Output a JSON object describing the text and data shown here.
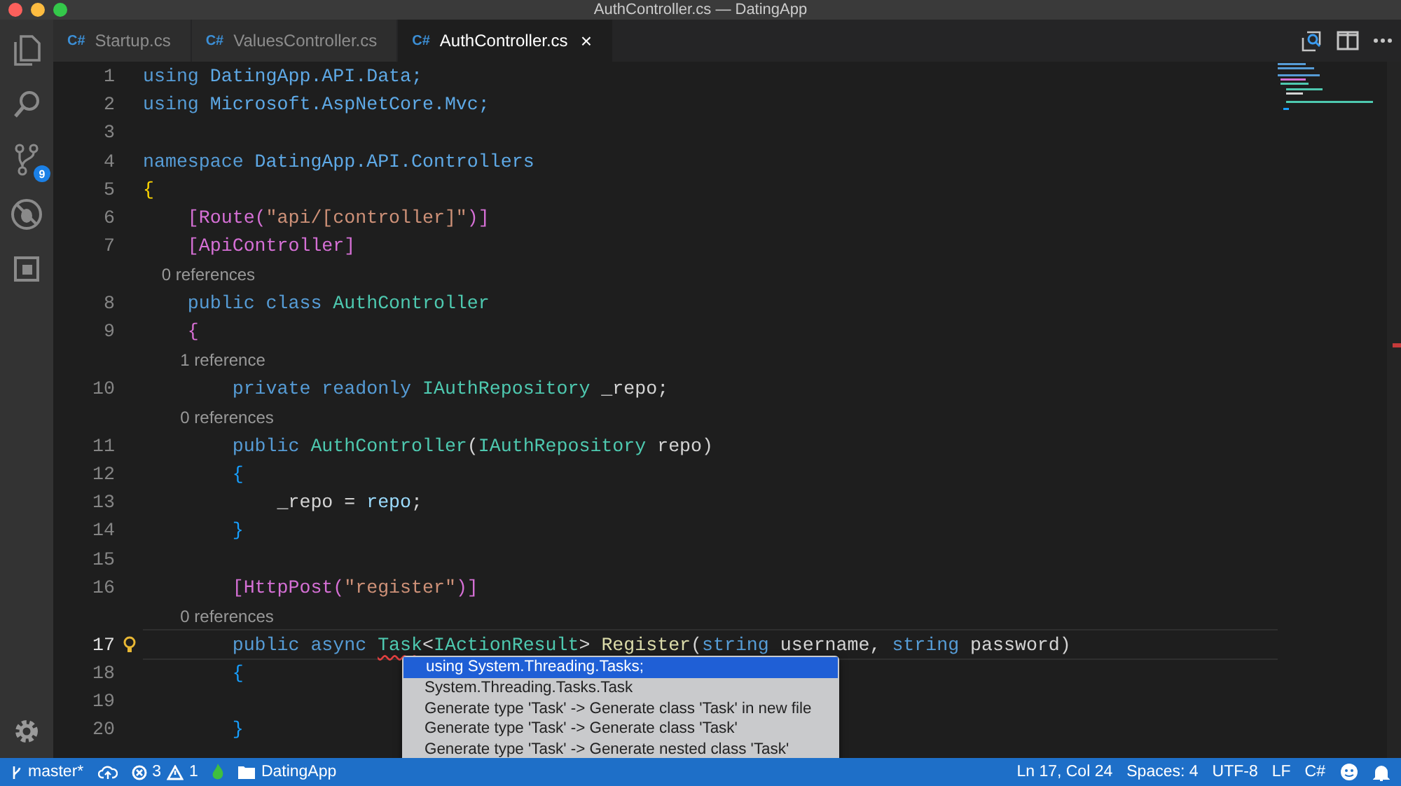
{
  "window": {
    "title": "AuthController.cs — DatingApp"
  },
  "activity_bar": {
    "source_control_badge": "9"
  },
  "tabs": [
    {
      "icon": "C#",
      "label": "Startup.cs",
      "selected": false
    },
    {
      "icon": "C#",
      "label": "ValuesController.cs",
      "selected": false
    },
    {
      "icon": "C#",
      "label": "AuthController.cs",
      "selected": true,
      "close": "×"
    }
  ],
  "lines": [
    {
      "kind": "code",
      "number": "1",
      "current": false,
      "lightbulb": false,
      "tokens": [
        {
          "text": "using",
          "kind": "kw"
        },
        {
          "text": " DatingApp.API.Data;",
          "kind": "ns"
        }
      ]
    },
    {
      "kind": "code",
      "number": "2",
      "current": false,
      "lightbulb": false,
      "tokens": [
        {
          "text": "using",
          "kind": "kw"
        },
        {
          "text": " Microsoft.AspNetCore.Mvc;",
          "kind": "ns"
        }
      ]
    },
    {
      "kind": "code",
      "number": "3",
      "current": false,
      "lightbulb": false
    },
    {
      "kind": "code",
      "number": "4",
      "current": false,
      "lightbulb": false,
      "tokens": [
        {
          "text": "namespace",
          "kind": "kw"
        },
        {
          "text": " DatingApp.API.Controllers",
          "kind": "ns"
        }
      ]
    },
    {
      "kind": "code",
      "number": "5",
      "current": false,
      "lightbulb": false,
      "tokens": [
        {
          "text": "{",
          "kind": "brace1"
        }
      ]
    },
    {
      "kind": "code",
      "number": "6",
      "current": false,
      "lightbulb": false,
      "tokens": [
        {
          "text": "    [Route(",
          "kind": "attr"
        },
        {
          "text": "\"api/[controller]\"",
          "kind": "str"
        },
        {
          "text": ")]",
          "kind": "attr"
        }
      ]
    },
    {
      "kind": "code",
      "number": "7",
      "current": false,
      "lightbulb": false,
      "tokens": [
        {
          "text": "    [ApiController]",
          "kind": "attr"
        }
      ]
    },
    {
      "kind": "lens",
      "text": "    0 references"
    },
    {
      "kind": "code",
      "number": "8",
      "current": false,
      "lightbulb": false,
      "tokens": [
        {
          "text": "    public class ",
          "kind": "kw"
        },
        {
          "text": "AuthController",
          "kind": "type"
        }
      ]
    },
    {
      "kind": "code",
      "number": "9",
      "current": false,
      "lightbulb": false,
      "tokens": [
        {
          "text": "    {",
          "kind": "brace2"
        }
      ]
    },
    {
      "kind": "lens",
      "text": "        1 reference"
    },
    {
      "kind": "code",
      "number": "10",
      "current": false,
      "lightbulb": false,
      "tokens": [
        {
          "text": "        private readonly ",
          "kind": "kw"
        },
        {
          "text": "IAuthRepository",
          "kind": "type"
        },
        {
          "text": " _repo;",
          "kind": "plain"
        }
      ]
    },
    {
      "kind": "lens",
      "text": "        0 references"
    },
    {
      "kind": "code",
      "number": "11",
      "current": false,
      "lightbulb": false,
      "tokens": [
        {
          "text": "        public ",
          "kind": "kw"
        },
        {
          "text": "AuthController",
          "kind": "type"
        },
        {
          "text": "(",
          "kind": "plain"
        },
        {
          "text": "IAuthRepository",
          "kind": "type"
        },
        {
          "text": " repo)",
          "kind": "plain"
        }
      ]
    },
    {
      "kind": "code",
      "number": "12",
      "current": false,
      "lightbulb": false,
      "tokens": [
        {
          "text": "        {",
          "kind": "brace3"
        }
      ]
    },
    {
      "kind": "code",
      "number": "13",
      "current": false,
      "lightbulb": false,
      "tokens": [
        {
          "text": "            _repo = ",
          "kind": "plain"
        },
        {
          "text": "repo",
          "kind": "var"
        },
        {
          "text": ";",
          "kind": "plain"
        }
      ]
    },
    {
      "kind": "code",
      "number": "14",
      "current": false,
      "lightbulb": false,
      "tokens": [
        {
          "text": "        }",
          "kind": "brace3"
        }
      ]
    },
    {
      "kind": "code",
      "number": "15",
      "current": false,
      "lightbulb": false
    },
    {
      "kind": "code",
      "number": "16",
      "current": false,
      "lightbulb": false,
      "tokens": [
        {
          "text": "        [HttpPost(",
          "kind": "attr"
        },
        {
          "text": "\"register\"",
          "kind": "str"
        },
        {
          "text": ")]",
          "kind": "attr"
        }
      ]
    },
    {
      "kind": "lens",
      "text": "        0 references"
    },
    {
      "kind": "code",
      "number": "17",
      "current": true,
      "lightbulb": true,
      "tokens": [
        {
          "text": "        public async ",
          "kind": "kw"
        },
        {
          "text": "Task",
          "kind": "type_error"
        },
        {
          "text": "<",
          "kind": "plain"
        },
        {
          "text": "IActionResult",
          "kind": "type"
        },
        {
          "text": "> ",
          "kind": "plain"
        },
        {
          "text": "Register",
          "kind": "fn"
        },
        {
          "text": "(",
          "kind": "plain"
        },
        {
          "text": "string",
          "kind": "kw"
        },
        {
          "text": " username, ",
          "kind": "plain"
        },
        {
          "text": "string",
          "kind": "kw"
        },
        {
          "text": " password)",
          "kind": "plain"
        }
      ]
    },
    {
      "kind": "code",
      "number": "18",
      "current": false,
      "lightbulb": false,
      "tokens": [
        {
          "text": "        {",
          "kind": "brace3"
        }
      ]
    },
    {
      "kind": "code",
      "number": "19",
      "current": false,
      "lightbulb": false
    },
    {
      "kind": "code",
      "number": "20",
      "current": false,
      "lightbulb": false,
      "tokens": [
        {
          "text": "        }",
          "kind": "brace3"
        }
      ]
    }
  ],
  "quick_fix_menu": [
    {
      "label": "using System.Threading.Tasks;",
      "selected": true
    },
    {
      "label": "System.Threading.Tasks.Task",
      "selected": false
    },
    {
      "label": "Generate type 'Task' -> Generate class 'Task' in new file",
      "selected": false
    },
    {
      "label": "Generate type 'Task' -> Generate class 'Task'",
      "selected": false
    },
    {
      "label": "Generate type 'Task' -> Generate nested class 'Task'",
      "selected": false
    }
  ],
  "status_bar": {
    "branch": "master*",
    "errors": "3",
    "warnings": "1",
    "folder": "DatingApp",
    "right": [
      "Ln 17, Col 24",
      "Spaces: 4",
      "UTF-8",
      "LF",
      "C#"
    ]
  }
}
